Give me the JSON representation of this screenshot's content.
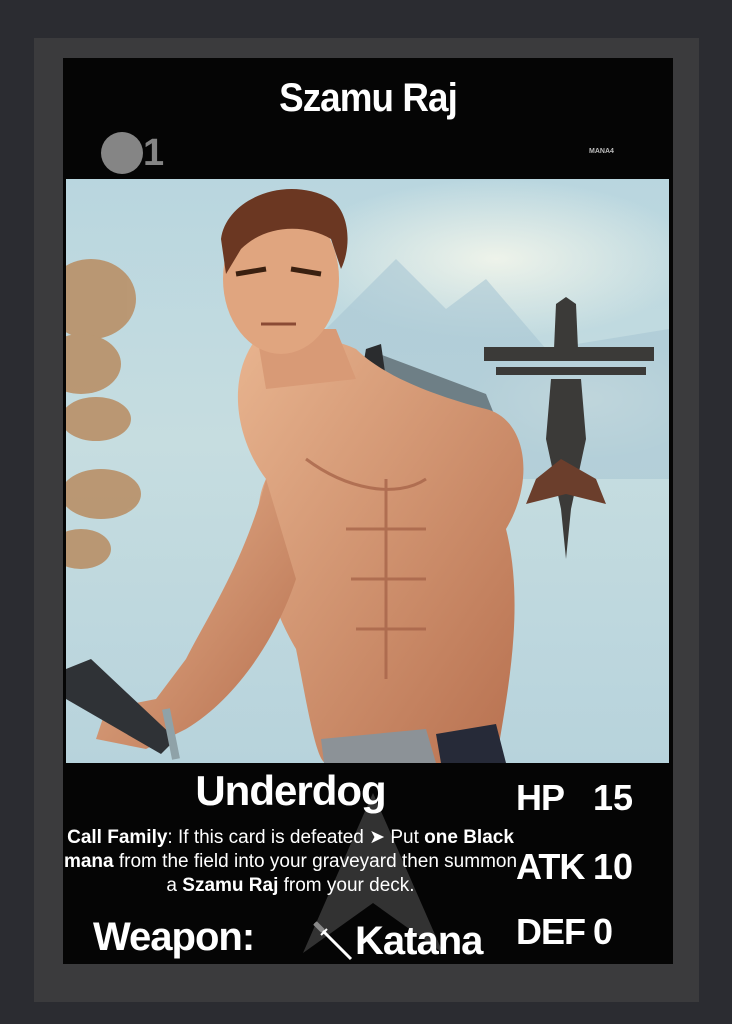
{
  "card": {
    "name": "Szamu Raj",
    "mana_cost": "1",
    "mana_tag": "MANA4",
    "ability_name": "Underdog",
    "ability": {
      "keyword": "Call Family",
      "part1": ": If this card is defeated ",
      "part2": " Put ",
      "bold1": "one",
      "bold2": "Black mana",
      "part3": " from the field into your graveyard then summon a ",
      "bold3": "Szamu Raj",
      "part4": " from your deck."
    },
    "weapon_label": "Weapon:",
    "weapon_name": "Katana",
    "weapon_icon": "katana-icon",
    "stats": {
      "hp_label": "HP",
      "hp": "15",
      "atk_label": "ATK",
      "atk": "10",
      "def_label": "DEF",
      "def": "0"
    }
  },
  "colors": {
    "background": "#2b2c31",
    "frame": "#3b3b3d",
    "card": "#050505",
    "text": "#ffffff",
    "mana_orb": "#858585"
  }
}
